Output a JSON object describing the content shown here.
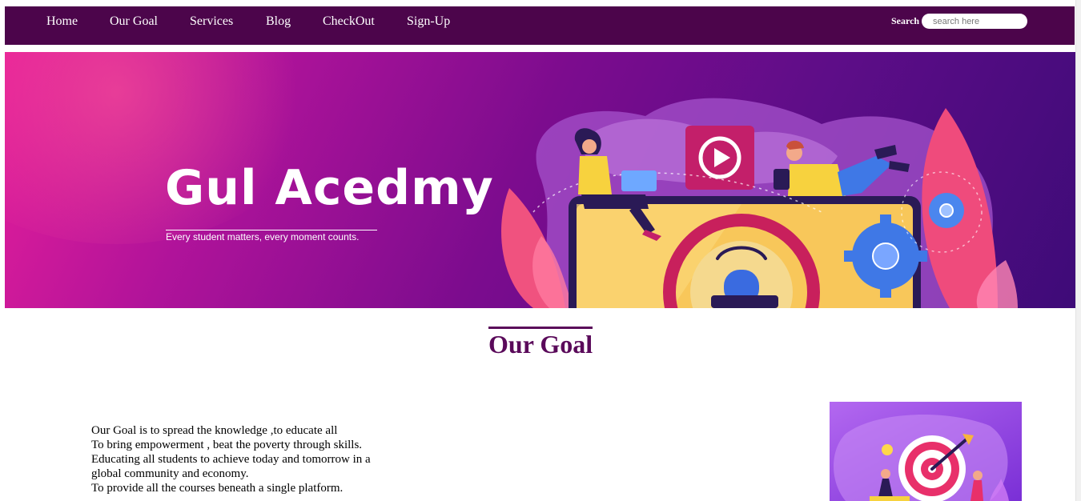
{
  "nav": {
    "items": [
      {
        "label": "Home"
      },
      {
        "label": "Our Goal"
      },
      {
        "label": "Services"
      },
      {
        "label": "Blog"
      },
      {
        "label": "CheckOut"
      },
      {
        "label": "Sign-Up"
      }
    ],
    "search_label": "Search",
    "search_placeholder": "search here"
  },
  "banner": {
    "title": "Gul Acedmy",
    "tagline": "Every student matters, every moment counts."
  },
  "goal": {
    "heading": "Our Goal",
    "lines": [
      "Our Goal is to spread the knowledge ,to educate all",
      "To bring empowerment , beat the poverty through skills.",
      "Educating all students to achieve today and tomorrow in a",
      "global community and economy.",
      "To provide all the courses beneath a single platform."
    ]
  },
  "colors": {
    "nav_bg": "#4c054b",
    "heading": "#5a0a5a",
    "banner_start": "#e61e9a",
    "banner_end": "#3e0b78"
  }
}
